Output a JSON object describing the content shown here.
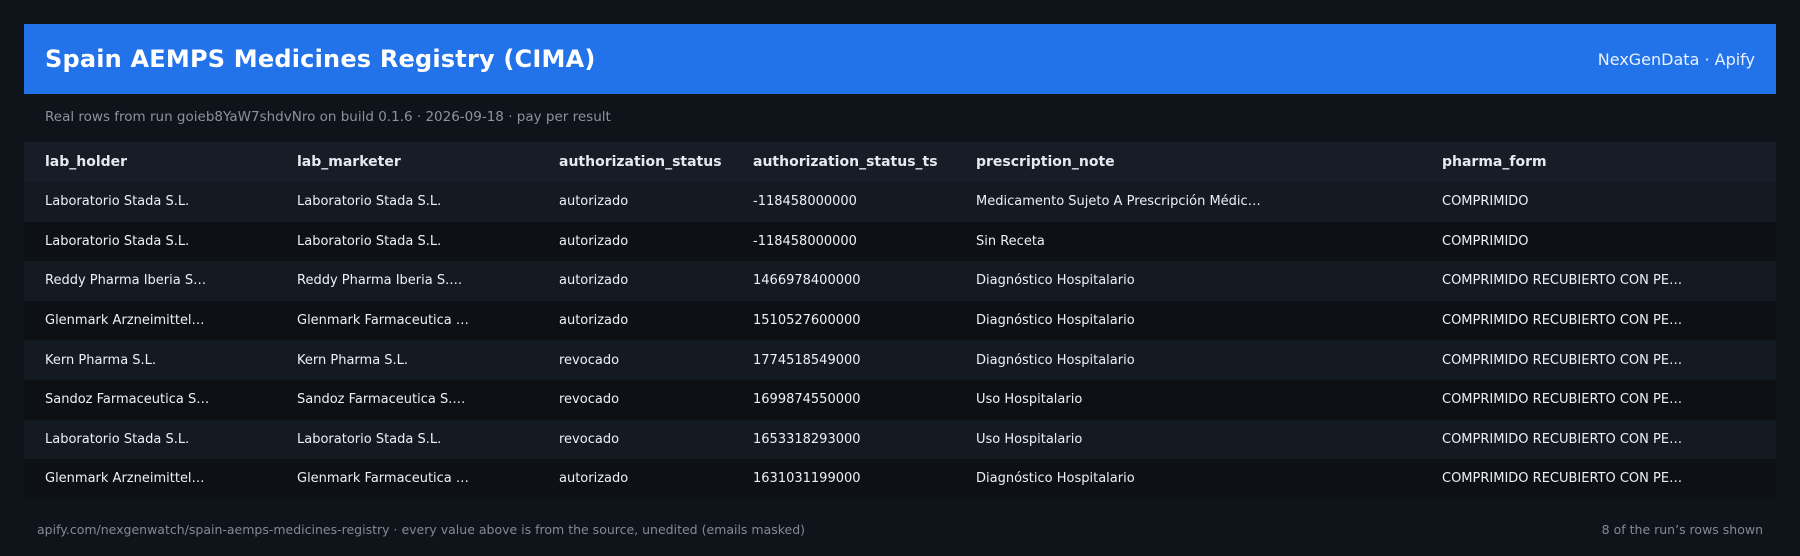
{
  "header": {
    "title": "Spain AEMPS Medicines Registry (CIMA)",
    "brand": "NexGenData · Apify",
    "bg_color": "#2272ea"
  },
  "subtitle": "Real rows from run goieb8YaW7shdvNro on build 0.1.6 · 2026-09-18 · pay per result",
  "table": {
    "columns": [
      "lab_holder",
      "lab_marketer",
      "authorization_status",
      "authorization_status_ts",
      "prescription_note",
      "pharma_form"
    ],
    "rows": [
      [
        "Laboratorio Stada S.L.",
        "Laboratorio Stada S.L.",
        "autorizado",
        "-118458000000",
        "Medicamento Sujeto A Prescripción Médic…",
        "COMPRIMIDO"
      ],
      [
        "Laboratorio Stada S.L.",
        "Laboratorio Stada S.L.",
        "autorizado",
        "-118458000000",
        "Sin Receta",
        "COMPRIMIDO"
      ],
      [
        "Reddy Pharma Iberia S…",
        "Reddy Pharma Iberia S.…",
        "autorizado",
        "1466978400000",
        "Diagnóstico Hospitalario",
        "COMPRIMIDO RECUBIERTO CON PE…"
      ],
      [
        "Glenmark Arzneimittel…",
        "Glenmark Farmaceutica …",
        "autorizado",
        "1510527600000",
        "Diagnóstico Hospitalario",
        "COMPRIMIDO RECUBIERTO CON PE…"
      ],
      [
        "Kern Pharma S.L.",
        "Kern Pharma S.L.",
        "revocado",
        "1774518549000",
        "Diagnóstico Hospitalario",
        "COMPRIMIDO RECUBIERTO CON PE…"
      ],
      [
        "Sandoz Farmaceutica S…",
        "Sandoz Farmaceutica S.…",
        "revocado",
        "1699874550000",
        "Uso Hospitalario",
        "COMPRIMIDO RECUBIERTO CON PE…"
      ],
      [
        "Laboratorio Stada S.L.",
        "Laboratorio Stada S.L.",
        "revocado",
        "1653318293000",
        "Uso Hospitalario",
        "COMPRIMIDO RECUBIERTO CON PE…"
      ],
      [
        "Glenmark Arzneimittel…",
        "Glenmark Farmaceutica …",
        "autorizado",
        "1631031199000",
        "Diagnóstico Hospitalario",
        "COMPRIMIDO RECUBIERTO CON PE…"
      ]
    ]
  },
  "footer": {
    "left": "apify.com/nexgenwatch/spain-aemps-medicines-registry  ·  every value above is from the source, unedited (emails masked)",
    "right": "8 of the run’s rows shown"
  }
}
